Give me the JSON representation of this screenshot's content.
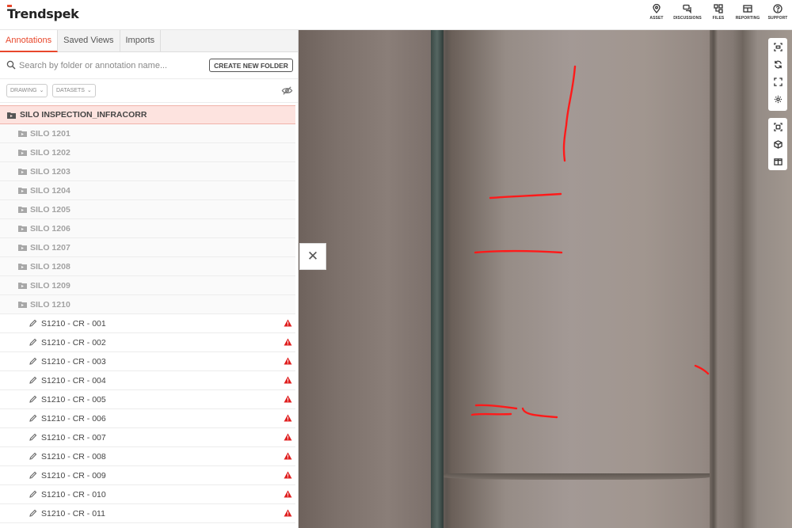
{
  "app": {
    "logo": "Trendspek"
  },
  "nav": [
    {
      "label": "ASSET",
      "icon": "map-pin-icon"
    },
    {
      "label": "DISCUSSIONS",
      "icon": "chat-icon"
    },
    {
      "label": "FILES",
      "icon": "files-icon"
    },
    {
      "label": "REPORTING",
      "icon": "table-icon"
    },
    {
      "label": "SUPPORT",
      "icon": "help-icon"
    }
  ],
  "tabs": [
    {
      "label": "Annotations",
      "active": true
    },
    {
      "label": "Saved Views",
      "active": false
    },
    {
      "label": "Imports",
      "active": false
    }
  ],
  "search": {
    "placeholder": "Search by folder or annotation name...",
    "value": ""
  },
  "create_folder_label": "CREATE NEW FOLDER",
  "filters": {
    "drawing": "DRAWING",
    "datasets": "DATASETS"
  },
  "tree": {
    "root": "SILO INSPECTION_INFRACORR",
    "folders": [
      "SILO 1201",
      "SILO 1202",
      "SILO 1203",
      "SILO 1204",
      "SILO 1205",
      "SILO 1206",
      "SILO 1207",
      "SILO 1208",
      "SILO 1209",
      "SILO 1210"
    ],
    "items": [
      "S1210 - CR - 001",
      "S1210 - CR - 002",
      "S1210 - CR - 003",
      "S1210 - CR - 004",
      "S1210 - CR - 005",
      "S1210 - CR - 006",
      "S1210 - CR - 007",
      "S1210 - CR - 008",
      "S1210 - CR - 009",
      "S1210 - CR - 010",
      "S1210 - CR - 011"
    ]
  },
  "viewer": {
    "annotation_color": "#ff1a1a",
    "toolbar_group1": [
      "vr-view-icon",
      "sync-icon",
      "fullscreen-icon",
      "settings-icon"
    ],
    "toolbar_group2": [
      "focus-icon",
      "cube-icon",
      "split-view-icon"
    ]
  },
  "colors": {
    "accent": "#e8472b",
    "warning": "#e02020"
  }
}
